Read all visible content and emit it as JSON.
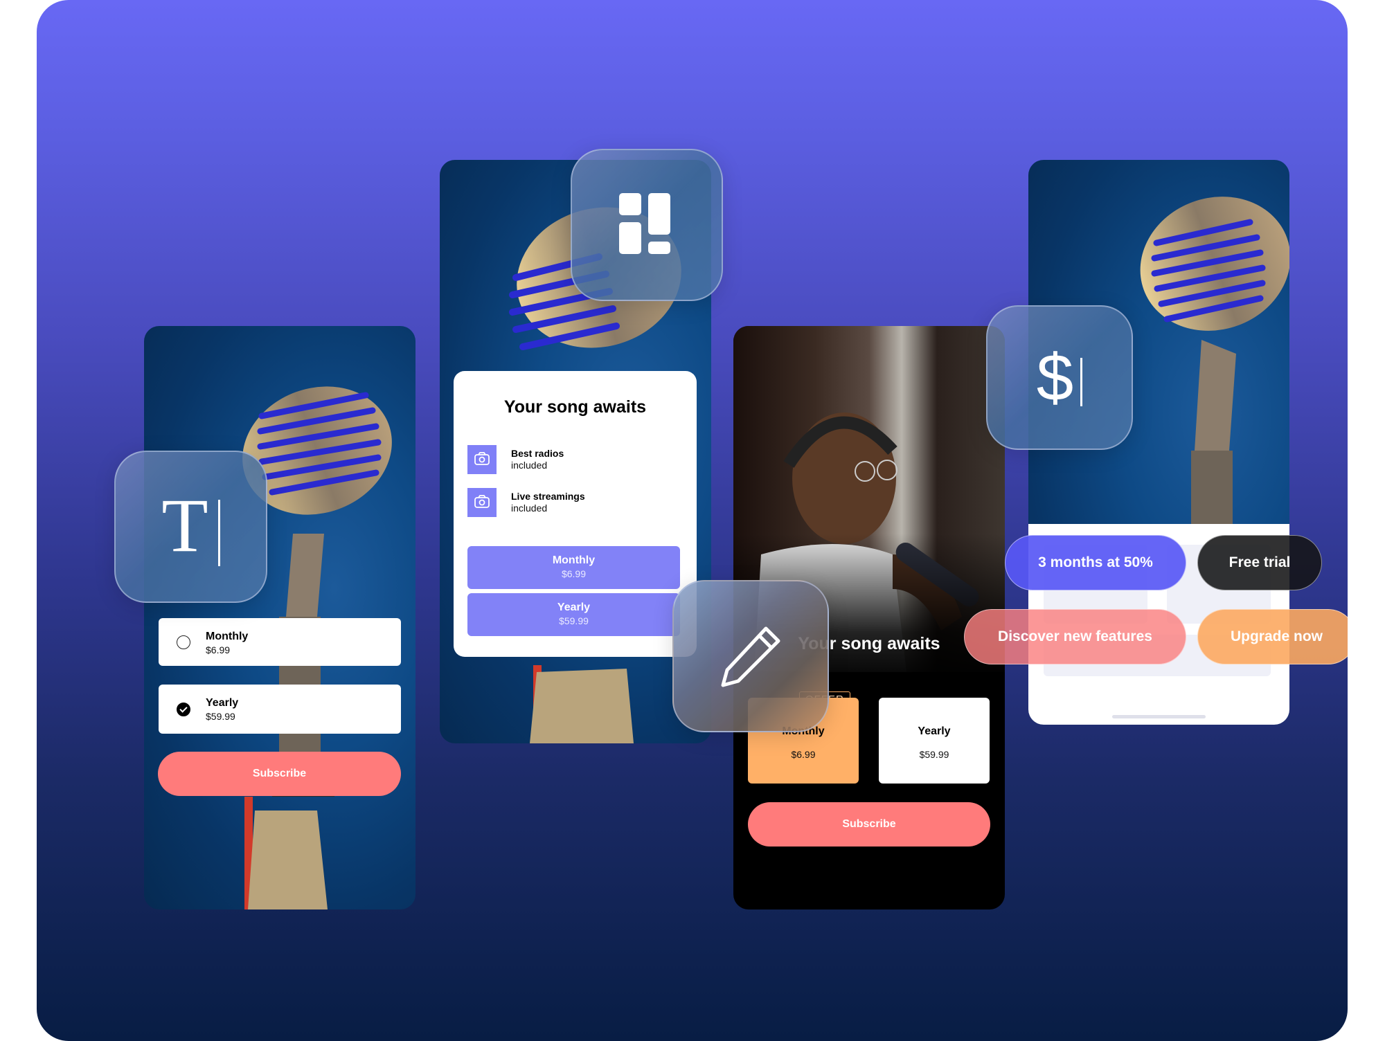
{
  "colors": {
    "accent_purple": "#8282f7",
    "subscribe_coral": "#ff7b7b",
    "offer_orange": "#ffb067",
    "promo_blue": "#5858f5",
    "promo_dark": "#141416"
  },
  "screen1": {
    "icon": "text-cursor-icon",
    "icon_glyph": "T",
    "options": [
      {
        "name": "Monthly",
        "price": "$6.99",
        "selected": false
      },
      {
        "name": "Yearly",
        "price": "$59.99",
        "selected": true
      }
    ],
    "subscribe_label": "Subscribe"
  },
  "screen2": {
    "icon": "layout-grid-icon",
    "title": "Your song awaits",
    "features": [
      {
        "icon": "camera-icon",
        "label": "Best radios",
        "sub": "included"
      },
      {
        "icon": "camera-icon",
        "label": "Live streamings",
        "sub": "included"
      }
    ],
    "plans": [
      {
        "name": "Monthly",
        "price": "$6.99"
      },
      {
        "name": "Yearly",
        "price": "$59.99"
      }
    ]
  },
  "screen3": {
    "icon": "pencil-icon",
    "title": "Your song awaits",
    "badge": "OFFER",
    "plans": [
      {
        "name": "Monthly",
        "price": "$6.99",
        "highlighted": true
      },
      {
        "name": "Yearly",
        "price": "$59.99",
        "highlighted": false
      }
    ],
    "subscribe_label": "Subscribe"
  },
  "screen4": {
    "icon": "dollar-cursor-icon",
    "icon_glyph": "$",
    "promos": [
      {
        "label": "3 months at 50%"
      },
      {
        "label": "Free trial"
      },
      {
        "label": "Discover new features"
      },
      {
        "label": "Upgrade now"
      }
    ]
  }
}
